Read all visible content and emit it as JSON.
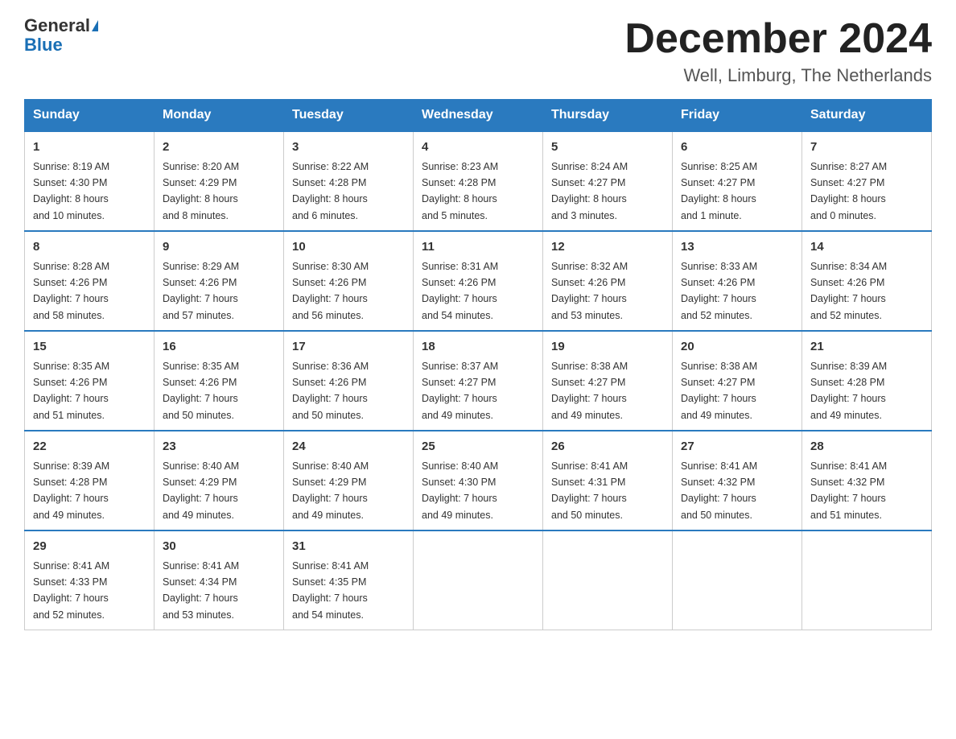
{
  "logo": {
    "general": "General",
    "blue": "Blue"
  },
  "header": {
    "month": "December 2024",
    "location": "Well, Limburg, The Netherlands"
  },
  "days_of_week": [
    "Sunday",
    "Monday",
    "Tuesday",
    "Wednesday",
    "Thursday",
    "Friday",
    "Saturday"
  ],
  "weeks": [
    [
      {
        "day": "1",
        "sunrise": "8:19 AM",
        "sunset": "4:30 PM",
        "daylight": "8 hours and 10 minutes."
      },
      {
        "day": "2",
        "sunrise": "8:20 AM",
        "sunset": "4:29 PM",
        "daylight": "8 hours and 8 minutes."
      },
      {
        "day": "3",
        "sunrise": "8:22 AM",
        "sunset": "4:28 PM",
        "daylight": "8 hours and 6 minutes."
      },
      {
        "day": "4",
        "sunrise": "8:23 AM",
        "sunset": "4:28 PM",
        "daylight": "8 hours and 5 minutes."
      },
      {
        "day": "5",
        "sunrise": "8:24 AM",
        "sunset": "4:27 PM",
        "daylight": "8 hours and 3 minutes."
      },
      {
        "day": "6",
        "sunrise": "8:25 AM",
        "sunset": "4:27 PM",
        "daylight": "8 hours and 1 minute."
      },
      {
        "day": "7",
        "sunrise": "8:27 AM",
        "sunset": "4:27 PM",
        "daylight": "8 hours and 0 minutes."
      }
    ],
    [
      {
        "day": "8",
        "sunrise": "8:28 AM",
        "sunset": "4:26 PM",
        "daylight": "7 hours and 58 minutes."
      },
      {
        "day": "9",
        "sunrise": "8:29 AM",
        "sunset": "4:26 PM",
        "daylight": "7 hours and 57 minutes."
      },
      {
        "day": "10",
        "sunrise": "8:30 AM",
        "sunset": "4:26 PM",
        "daylight": "7 hours and 56 minutes."
      },
      {
        "day": "11",
        "sunrise": "8:31 AM",
        "sunset": "4:26 PM",
        "daylight": "7 hours and 54 minutes."
      },
      {
        "day": "12",
        "sunrise": "8:32 AM",
        "sunset": "4:26 PM",
        "daylight": "7 hours and 53 minutes."
      },
      {
        "day": "13",
        "sunrise": "8:33 AM",
        "sunset": "4:26 PM",
        "daylight": "7 hours and 52 minutes."
      },
      {
        "day": "14",
        "sunrise": "8:34 AM",
        "sunset": "4:26 PM",
        "daylight": "7 hours and 52 minutes."
      }
    ],
    [
      {
        "day": "15",
        "sunrise": "8:35 AM",
        "sunset": "4:26 PM",
        "daylight": "7 hours and 51 minutes."
      },
      {
        "day": "16",
        "sunrise": "8:35 AM",
        "sunset": "4:26 PM",
        "daylight": "7 hours and 50 minutes."
      },
      {
        "day": "17",
        "sunrise": "8:36 AM",
        "sunset": "4:26 PM",
        "daylight": "7 hours and 50 minutes."
      },
      {
        "day": "18",
        "sunrise": "8:37 AM",
        "sunset": "4:27 PM",
        "daylight": "7 hours and 49 minutes."
      },
      {
        "day": "19",
        "sunrise": "8:38 AM",
        "sunset": "4:27 PM",
        "daylight": "7 hours and 49 minutes."
      },
      {
        "day": "20",
        "sunrise": "8:38 AM",
        "sunset": "4:27 PM",
        "daylight": "7 hours and 49 minutes."
      },
      {
        "day": "21",
        "sunrise": "8:39 AM",
        "sunset": "4:28 PM",
        "daylight": "7 hours and 49 minutes."
      }
    ],
    [
      {
        "day": "22",
        "sunrise": "8:39 AM",
        "sunset": "4:28 PM",
        "daylight": "7 hours and 49 minutes."
      },
      {
        "day": "23",
        "sunrise": "8:40 AM",
        "sunset": "4:29 PM",
        "daylight": "7 hours and 49 minutes."
      },
      {
        "day": "24",
        "sunrise": "8:40 AM",
        "sunset": "4:29 PM",
        "daylight": "7 hours and 49 minutes."
      },
      {
        "day": "25",
        "sunrise": "8:40 AM",
        "sunset": "4:30 PM",
        "daylight": "7 hours and 49 minutes."
      },
      {
        "day": "26",
        "sunrise": "8:41 AM",
        "sunset": "4:31 PM",
        "daylight": "7 hours and 50 minutes."
      },
      {
        "day": "27",
        "sunrise": "8:41 AM",
        "sunset": "4:32 PM",
        "daylight": "7 hours and 50 minutes."
      },
      {
        "day": "28",
        "sunrise": "8:41 AM",
        "sunset": "4:32 PM",
        "daylight": "7 hours and 51 minutes."
      }
    ],
    [
      {
        "day": "29",
        "sunrise": "8:41 AM",
        "sunset": "4:33 PM",
        "daylight": "7 hours and 52 minutes."
      },
      {
        "day": "30",
        "sunrise": "8:41 AM",
        "sunset": "4:34 PM",
        "daylight": "7 hours and 53 minutes."
      },
      {
        "day": "31",
        "sunrise": "8:41 AM",
        "sunset": "4:35 PM",
        "daylight": "7 hours and 54 minutes."
      },
      null,
      null,
      null,
      null
    ]
  ],
  "labels": {
    "sunrise": "Sunrise:",
    "sunset": "Sunset:",
    "daylight": "Daylight:"
  }
}
